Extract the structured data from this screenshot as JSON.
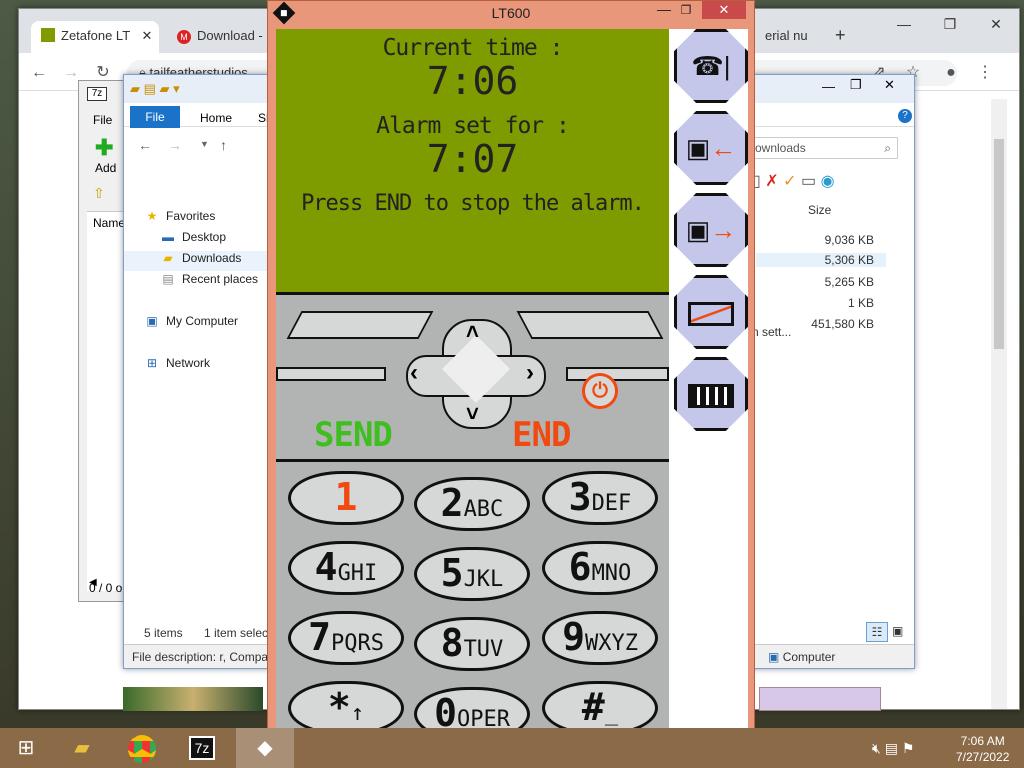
{
  "chrome": {
    "tabs": [
      {
        "label": "Zetafone LT"
      },
      {
        "label": "Download -"
      },
      {
        "label": "erial nu"
      }
    ],
    "new_tab": "+",
    "address": "tailfeatherstudios",
    "minimize": "—",
    "maximize": "❐",
    "close": "✕"
  },
  "sevenz": {
    "title": "7z",
    "menu_file": "File",
    "add_label": "Add",
    "col_name": "Name",
    "status": "0 / 0 o"
  },
  "explorer": {
    "ribbon": {
      "file": "File",
      "home": "Home",
      "share": "Sh"
    },
    "search_placeholder": "ownloads",
    "nav": {
      "favorites": "Favorites",
      "desktop": "Desktop",
      "downloads": "Downloads",
      "recent": "Recent places",
      "computer": "My Computer",
      "network": "Network"
    },
    "col_size": "Size",
    "sizes": [
      "9,036 KB",
      "5,306 KB",
      "5,265 KB",
      "1 KB",
      "451,580 KB"
    ],
    "partial_name": "n sett...",
    "status_items": "5 items",
    "status_selected": "1 item selec",
    "description": "File description: r, Compa",
    "location": "Computer"
  },
  "lt600": {
    "title": "LT600",
    "screen": {
      "current_label": "Current time :",
      "current_time": "7:06",
      "alarm_label": "Alarm set for :",
      "alarm_time": "7:07",
      "instruction": "Press END to stop the alarm."
    },
    "send_label": "SEND",
    "end_label": "END",
    "keys": [
      {
        "digit": "1",
        "letters": ""
      },
      {
        "digit": "2",
        "letters": "ABC"
      },
      {
        "digit": "3",
        "letters": "DEF"
      },
      {
        "digit": "4",
        "letters": "GHI"
      },
      {
        "digit": "5",
        "letters": "JKL"
      },
      {
        "digit": "6",
        "letters": "MNO"
      },
      {
        "digit": "7",
        "letters": "PQRS"
      },
      {
        "digit": "8",
        "letters": "TUV"
      },
      {
        "digit": "9",
        "letters": "WXYZ"
      },
      {
        "digit": "*",
        "letters": "↑"
      },
      {
        "digit": "0",
        "letters": "OPER"
      },
      {
        "digit": "#",
        "letters": "_"
      }
    ],
    "side_buttons": [
      "phone-settings-icon",
      "load-icon",
      "save-icon",
      "battery-empty-icon",
      "battery-full-icon"
    ]
  },
  "taskbar": {
    "time": "7:06 AM",
    "date": "7/27/2022"
  },
  "colors": {
    "lcd": "#7e9c00",
    "send": "#3fbf1f",
    "end": "#f04a10",
    "lt_frame": "#e8977a"
  }
}
